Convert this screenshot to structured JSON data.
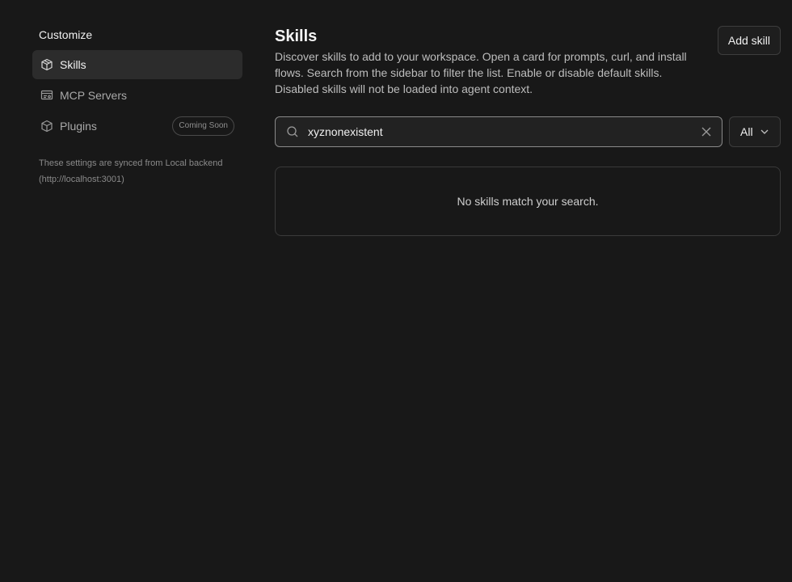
{
  "sidebar": {
    "heading": "Customize",
    "items": [
      {
        "label": "Skills",
        "icon": "skills-icon",
        "active": true
      },
      {
        "label": "MCP Servers",
        "icon": "server-icon",
        "active": false
      },
      {
        "label": "Plugins",
        "icon": "cube-icon",
        "active": false,
        "badge": "Coming Soon"
      }
    ],
    "sync_note": "These settings are synced from Local backend (http://localhost:3001)"
  },
  "main": {
    "title": "Skills",
    "description": "Discover skills to add to your workspace. Open a card for prompts, curl, and install flows. Search from the sidebar to filter the list. Enable or disable default skills. Disabled skills will not be loaded into agent context.",
    "add_button": "Add skill",
    "search": {
      "value": "xyznonexistent",
      "placeholder": ""
    },
    "filter": {
      "selected": "All"
    },
    "empty_message": "No skills match your search."
  },
  "colors": {
    "background": "#181818",
    "active_item": "#2c2c2c",
    "border": "#3d3d3d"
  }
}
